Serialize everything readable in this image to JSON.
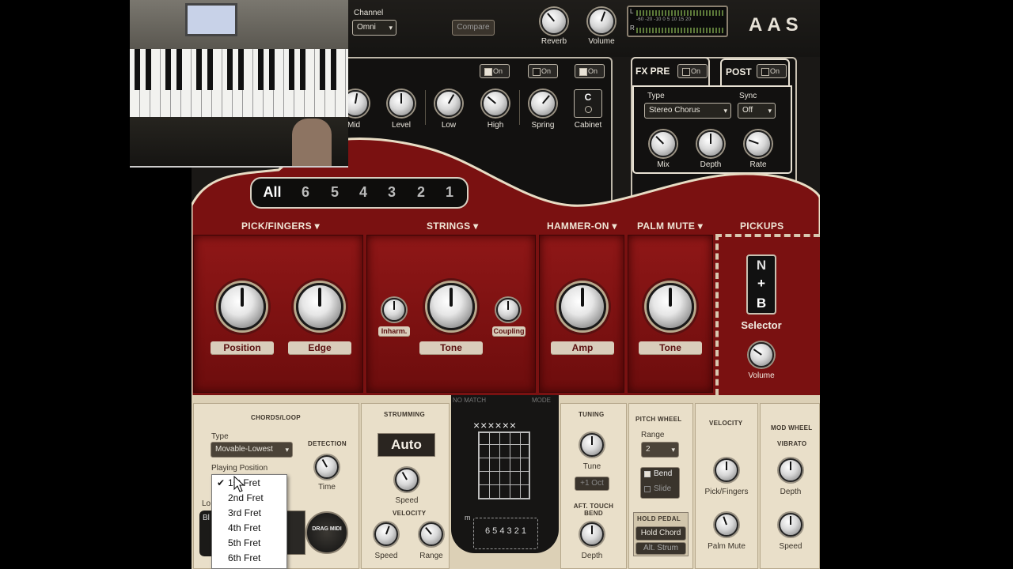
{
  "colors": {
    "accent_red": "#8f1717",
    "cream": "#e9dfc9",
    "panel_dark": "#121110",
    "knob_white": "#e6e6e6"
  },
  "header": {
    "channel_label": "Channel",
    "channel_value": "Omni",
    "compare_label": "Compare",
    "reverb_label": "Reverb",
    "volume_label": "Volume",
    "meter_scale": "-60 -20 -10 0 5 10 15 20",
    "meter_l": "L",
    "meter_r": "R",
    "brand": "AAS"
  },
  "amp": {
    "on_labels": [
      "On",
      "On",
      "On"
    ],
    "knobs": [
      "Mid",
      "Level",
      "Low",
      "High",
      "Spring"
    ],
    "cabinet_label": "Cabinet",
    "cabinet_letter": "C"
  },
  "fx": {
    "pre_label": "FX PRE",
    "post_label": "POST",
    "on_labels": [
      "On",
      "On"
    ],
    "type_label": "Type",
    "type_value": "Stereo Chorus",
    "sync_label": "Sync",
    "sync_value": "Off",
    "knobs": [
      "Mix",
      "Depth",
      "Rate"
    ]
  },
  "string_tabs": [
    "All",
    "6",
    "5",
    "4",
    "3",
    "2",
    "1"
  ],
  "sections": {
    "pick": "PICK/FINGERS ▾",
    "strings": "STRINGS ▾",
    "hammer": "HAMMER-ON ▾",
    "palm": "PALM MUTE ▾",
    "pickups": "PICKUPS"
  },
  "knob_pills": {
    "position": "Position",
    "edge": "Edge",
    "inharm": "Inharm.",
    "tone": "Tone",
    "coupling": "Coupling",
    "amp": "Amp",
    "palm_tone": "Tone"
  },
  "pickups": {
    "n": "N",
    "plus": "+",
    "b": "B",
    "selector": "Selector",
    "volume": "Volume"
  },
  "lower": {
    "chords_title": "CHORDS/LOOP",
    "type_label": "Type",
    "type_value": "Movable-Lowest",
    "detection_label": "DETECTION",
    "playing_position_label": "Playing Position",
    "time_label": "Time",
    "strumming_title": "STRUMMING",
    "auto_label": "Auto",
    "speed_label": "Speed",
    "velocity_title": "VELOCITY",
    "vel_speed": "Speed",
    "vel_range": "Range",
    "fretboard_top": "NO MATCH",
    "fretboard_top_r": "MODE",
    "fret_x": "××××××",
    "fret_numbers": "6 5 4 3 2 1",
    "fret_m": "m",
    "tuning_title": "TUNING",
    "tune_label": "Tune",
    "tune_button": "+1 Oct",
    "aft_touch_title": "AFT. TOUCH BEND",
    "aft_depth": "Depth",
    "pitch_title": "PITCH WHEEL",
    "range_label": "Range",
    "range_value": "2",
    "bend_label": "Bend",
    "slide_label": "Slide",
    "hold_title": "HOLD PEDAL",
    "hold_chord": "Hold Chord",
    "alt_strum": "Alt. Strum",
    "velocity2_title": "VELOCITY",
    "pick_fingers": "Pick/Fingers",
    "palm_mute": "Palm Mute",
    "modwheel_title": "MOD WHEEL",
    "vibrato_title": "VIBRATO",
    "mw_depth": "Depth",
    "mw_speed": "Speed",
    "drag_midi": "DRAG MIDI",
    "loop_label": "Lo",
    "loop_value": "Bl"
  },
  "menu": {
    "items": [
      "1st Fret",
      "2nd Fret",
      "3rd Fret",
      "4th Fret",
      "5th Fret",
      "6th Fret"
    ],
    "checked_index": 0
  }
}
